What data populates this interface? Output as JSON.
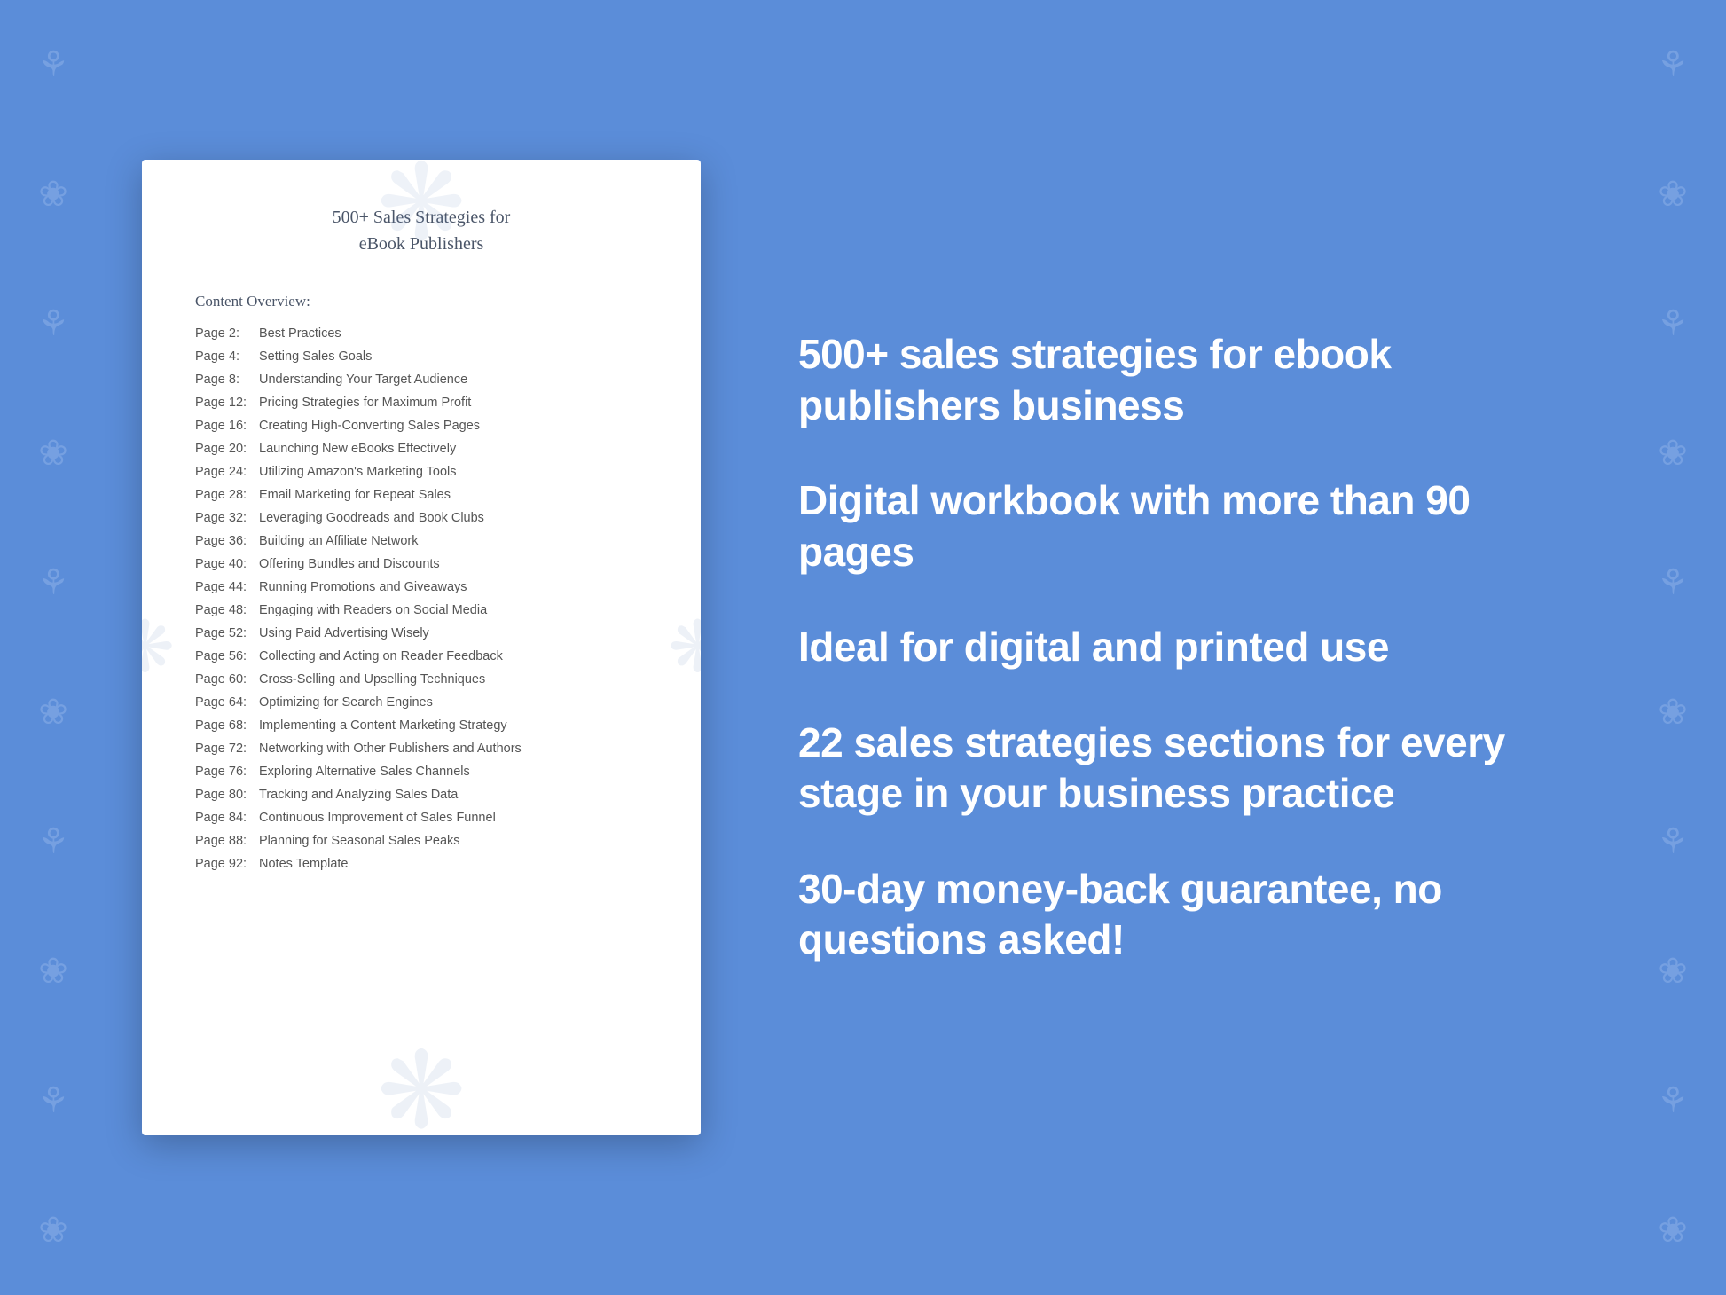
{
  "background_color": "#5b8dd9",
  "floral_symbol": "❀",
  "document": {
    "title_line1": "500+ Sales Strategies for",
    "title_line2": "eBook Publishers",
    "content_overview_label": "Content Overview:",
    "toc_items": [
      {
        "page": "Page  2:",
        "title": "Best Practices"
      },
      {
        "page": "Page  4:",
        "title": "Setting Sales Goals"
      },
      {
        "page": "Page  8:",
        "title": "Understanding Your Target Audience"
      },
      {
        "page": "Page 12:",
        "title": "Pricing Strategies for Maximum Profit"
      },
      {
        "page": "Page 16:",
        "title": "Creating High-Converting Sales Pages"
      },
      {
        "page": "Page 20:",
        "title": "Launching New eBooks Effectively"
      },
      {
        "page": "Page 24:",
        "title": "Utilizing Amazon's Marketing Tools"
      },
      {
        "page": "Page 28:",
        "title": "Email Marketing for Repeat Sales"
      },
      {
        "page": "Page 32:",
        "title": "Leveraging Goodreads and Book Clubs"
      },
      {
        "page": "Page 36:",
        "title": "Building an Affiliate Network"
      },
      {
        "page": "Page 40:",
        "title": "Offering Bundles and Discounts"
      },
      {
        "page": "Page 44:",
        "title": "Running Promotions and Giveaways"
      },
      {
        "page": "Page 48:",
        "title": "Engaging with Readers on Social Media"
      },
      {
        "page": "Page 52:",
        "title": "Using Paid Advertising Wisely"
      },
      {
        "page": "Page 56:",
        "title": "Collecting and Acting on Reader Feedback"
      },
      {
        "page": "Page 60:",
        "title": "Cross-Selling and Upselling Techniques"
      },
      {
        "page": "Page 64:",
        "title": "Optimizing for Search Engines"
      },
      {
        "page": "Page 68:",
        "title": "Implementing a Content Marketing Strategy"
      },
      {
        "page": "Page 72:",
        "title": "Networking with Other Publishers and Authors"
      },
      {
        "page": "Page 76:",
        "title": "Exploring Alternative Sales Channels"
      },
      {
        "page": "Page 80:",
        "title": "Tracking and Analyzing Sales Data"
      },
      {
        "page": "Page 84:",
        "title": "Continuous Improvement of Sales Funnel"
      },
      {
        "page": "Page 88:",
        "title": "Planning for Seasonal Sales Peaks"
      },
      {
        "page": "Page 92:",
        "title": "Notes Template"
      }
    ]
  },
  "features": [
    "500+ sales strategies for ebook publishers business",
    "Digital workbook with more than 90 pages",
    "Ideal for digital and printed use",
    "22 sales strategies sections for every stage in your business practice",
    "30-day money-back guarantee, no questions asked!"
  ]
}
